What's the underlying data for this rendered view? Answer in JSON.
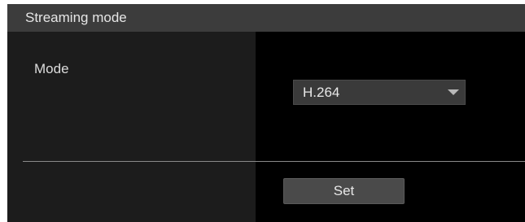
{
  "section": {
    "title": "Streaming mode"
  },
  "mode": {
    "label": "Mode",
    "selected": "H.264",
    "arrow_icon": "chevron-down-icon"
  },
  "actions": {
    "set_label": "Set"
  }
}
